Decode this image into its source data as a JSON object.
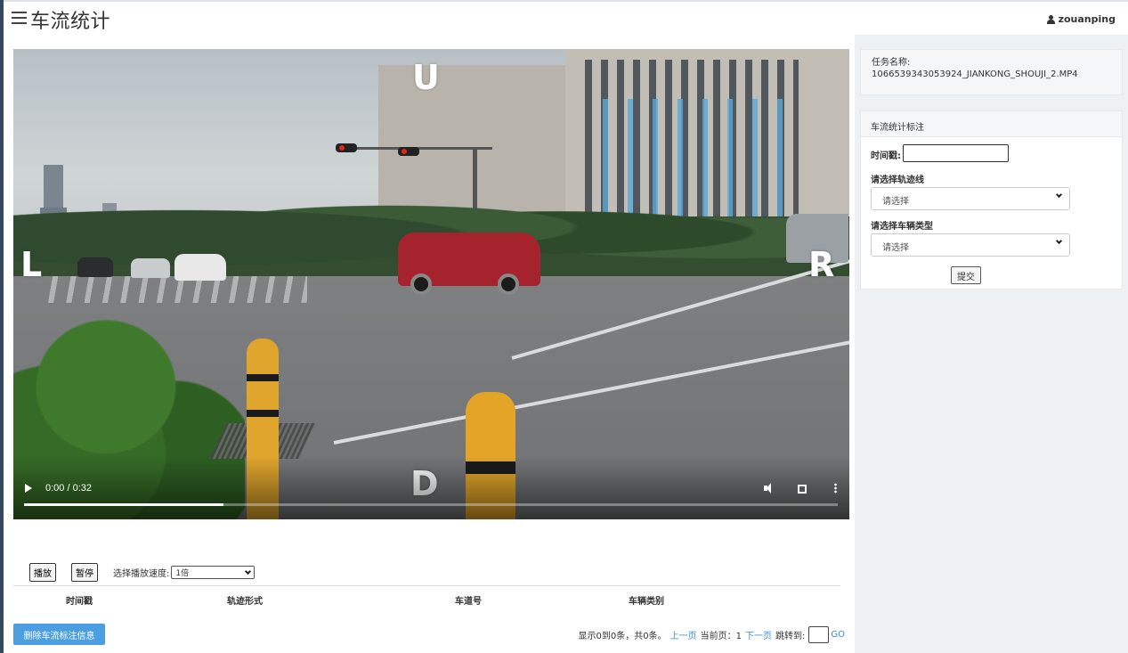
{
  "header": {
    "title": "车流统计",
    "username": "zouanping"
  },
  "video": {
    "direction_labels": {
      "up": "U",
      "left": "L",
      "right": "R",
      "down": "D"
    },
    "time_display": "0:00 / 0:32",
    "progress_fraction": 0.245
  },
  "playback": {
    "play_label": "播放",
    "pause_label": "暂停",
    "speed_label": "选择播放速度:",
    "speed_value": "1倍"
  },
  "table": {
    "columns": [
      "时间戳",
      "轨迹形式",
      "车道号",
      "车辆类别"
    ]
  },
  "actions": {
    "delete_label": "删除车流标注信息"
  },
  "pager": {
    "summary": "显示0到0条，共0条。",
    "prev": "上一页",
    "current": "当前页：1",
    "next": "下一页",
    "jump": "跳转到:",
    "go": "GO"
  },
  "task": {
    "name_label": "任务名称:",
    "name_value": "1066539343053924_JIANKONG_SHOUJI_2.MP4"
  },
  "annotation": {
    "title": "车流统计标注",
    "timestamp_label": "时间戳:",
    "track_label": "请选择轨迹线",
    "track_placeholder": "请选择",
    "vehicle_label": "请选择车辆类型",
    "vehicle_placeholder": "请选择",
    "submit_label": "提交"
  },
  "colors": {
    "primary_button": "#4b9fe0",
    "link": "#3b8fd4",
    "sidebar_edge": "#34495e"
  }
}
